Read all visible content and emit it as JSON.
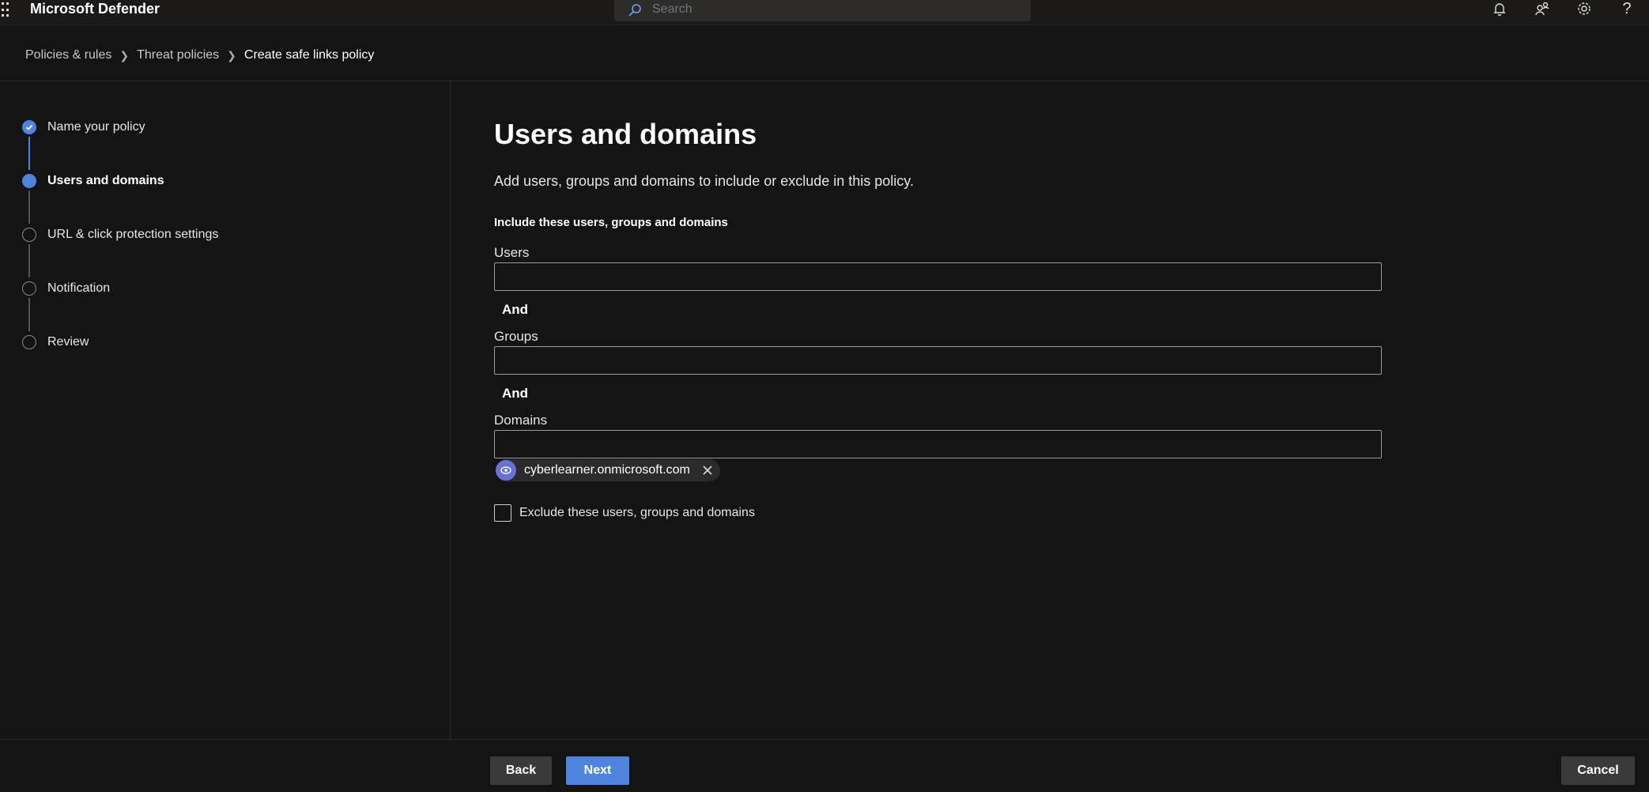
{
  "app": {
    "title": "Microsoft Defender"
  },
  "search": {
    "placeholder": "Search"
  },
  "topbar": {
    "icons": [
      "bell-icon",
      "people-icon",
      "gear-icon",
      "help-icon"
    ],
    "help_label": "?"
  },
  "breadcrumb": {
    "items": [
      "Policies & rules",
      "Threat policies",
      "Create safe links policy"
    ]
  },
  "steps": [
    {
      "label": "Name your policy",
      "state": "done"
    },
    {
      "label": "Users and domains",
      "state": "active"
    },
    {
      "label": "URL & click protection settings",
      "state": "pending"
    },
    {
      "label": "Notification",
      "state": "pending"
    },
    {
      "label": "Review",
      "state": "pending"
    }
  ],
  "main": {
    "title": "Users and domains",
    "description": "Add users, groups and domains to include or exclude in this policy.",
    "section_label": "Include these users, groups and domains",
    "users_label": "Users",
    "users_value": "",
    "and_label": "And",
    "groups_label": "Groups",
    "groups_value": "",
    "domains_label": "Domains",
    "domains_value": "",
    "domain_chip": "cyberlearner.onmicrosoft.com",
    "exclude_label": "Exclude these users, groups and domains"
  },
  "footer": {
    "back_label": "Back",
    "next_label": "Next",
    "cancel_label": "Cancel"
  },
  "colors": {
    "accent": "#4f84de",
    "background": "#141414",
    "topbar": "#1b1a19"
  }
}
